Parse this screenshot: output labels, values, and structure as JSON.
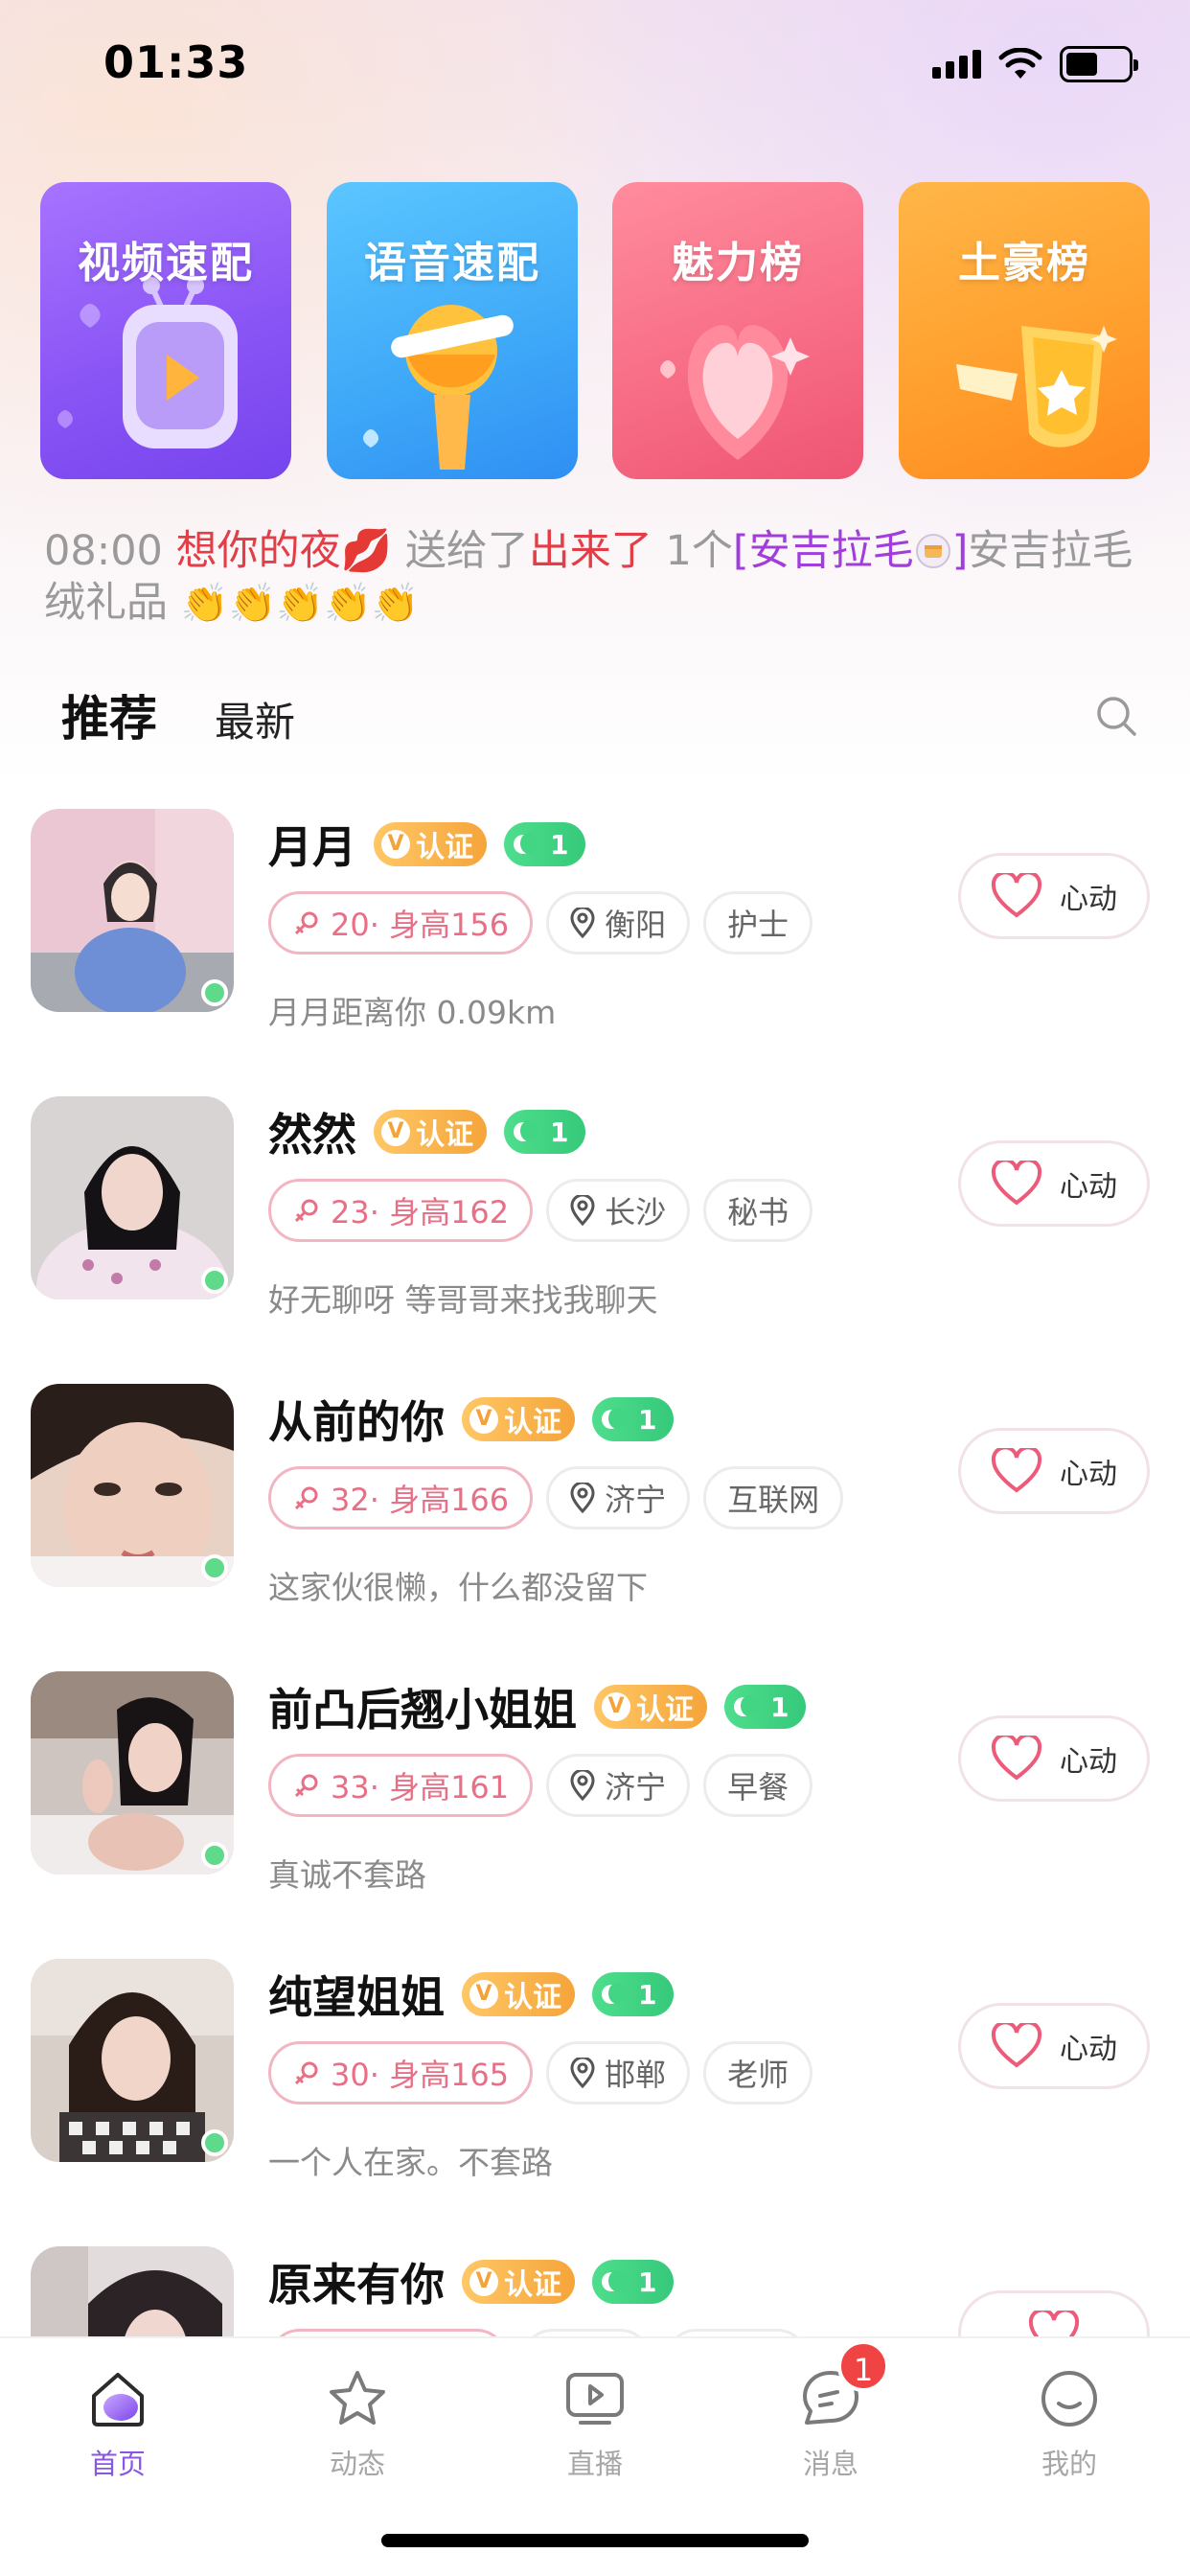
{
  "status_bar": {
    "time": "01:33"
  },
  "tiles": [
    {
      "label": "视频速配",
      "color": "#8a55f5"
    },
    {
      "label": "语音速配",
      "color": "#3ea8f8"
    },
    {
      "label": "魅力榜",
      "color": "#f76b84"
    },
    {
      "label": "土豪榜",
      "color": "#ff9e2c"
    }
  ],
  "broadcast": {
    "time": "08:00",
    "sender": "想你的夜",
    "verb": "送给了",
    "receiver": "出来了",
    "count": "1个",
    "gift_bracket": "[安吉拉毛",
    "gift_close": "]",
    "gift_desc": "安吉拉毛绒礼品",
    "claps": "👏👏👏👏👏",
    "lips": "💋"
  },
  "tabs": {
    "recommend": "推荐",
    "latest": "最新"
  },
  "users": [
    {
      "name": "月月",
      "verified": "认证",
      "level": "1",
      "age_height": "20· 身高156",
      "city": "衡阳",
      "job": "护士",
      "bio": "月月距离你 0.09km",
      "like": "心动"
    },
    {
      "name": "然然",
      "verified": "认证",
      "level": "1",
      "age_height": "23· 身高162",
      "city": "长沙",
      "job": "秘书",
      "bio": "好无聊呀 等哥哥来找我聊天",
      "like": "心动"
    },
    {
      "name": "从前的你",
      "verified": "认证",
      "level": "1",
      "age_height": "32· 身高166",
      "city": "济宁",
      "job": "互联网",
      "bio": "这家伙很懒，什么都没留下",
      "like": "心动"
    },
    {
      "name": "前凸后翘小姐姐",
      "verified": "认证",
      "level": "1",
      "age_height": "33· 身高161",
      "city": "济宁",
      "job": "早餐",
      "bio": "真诚不套路",
      "like": "心动"
    },
    {
      "name": "纯望姐姐",
      "verified": "认证",
      "level": "1",
      "age_height": "30· 身高165",
      "city": "邯郸",
      "job": "老师",
      "bio": "一个人在家。不套路",
      "like": "心动"
    },
    {
      "name": "原来有你",
      "verified": "认证",
      "level": "1"
    }
  ],
  "nav": [
    {
      "label": "首页",
      "icon": "home-icon",
      "active": true
    },
    {
      "label": "动态",
      "icon": "star-icon"
    },
    {
      "label": "直播",
      "icon": "live-tv-icon"
    },
    {
      "label": "消息",
      "icon": "message-icon",
      "badge": "1"
    },
    {
      "label": "我的",
      "icon": "profile-smile-icon"
    }
  ]
}
